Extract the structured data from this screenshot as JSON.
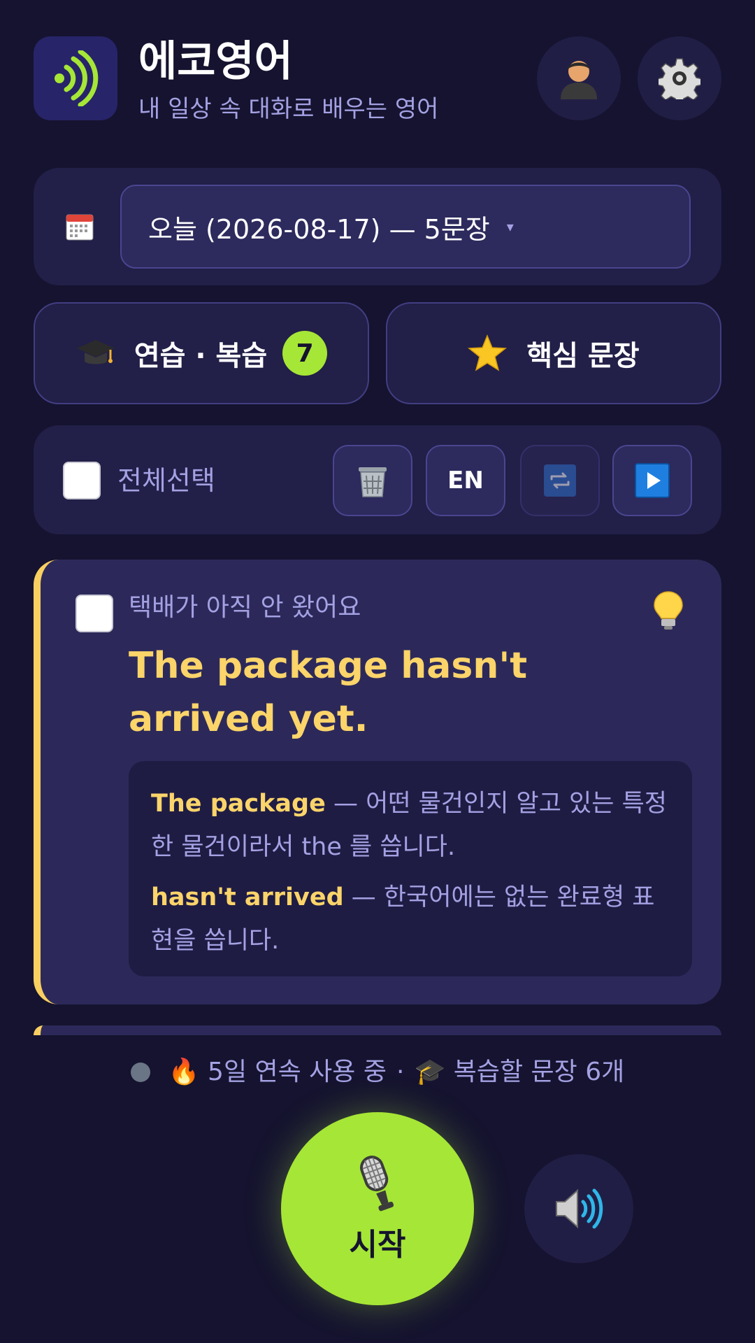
{
  "header": {
    "title": "에코영어",
    "subtitle": "내 일상 속 대화로 배우는 영어",
    "logo_icon": "echo-waves-icon",
    "profile_icon": "profile-icon",
    "settings_icon": "gear-icon"
  },
  "date_selector": {
    "icon": "calendar-icon",
    "value": "오늘 (2026-08-17) — 5문장",
    "caret": "▾"
  },
  "actions": {
    "practice_label": "연습 · 복습",
    "practice_badge": "7",
    "core_label": "핵심 문장"
  },
  "toolbar": {
    "select_all_label": "전체선택",
    "lang_label": "EN"
  },
  "card": {
    "korean": "택배가 아직 안 왔어요",
    "english": "The package hasn't arrived yet.",
    "explanations": [
      {
        "keyword": "The package",
        "text": " — 어떤 물건인지 알고 있는 특정한 물건이라서 the 를 씁니다."
      },
      {
        "keyword": "hasn't arrived",
        "text": " — 한국어에는 없는 완료형 표현을 씁니다."
      }
    ]
  },
  "status": {
    "streak": "🔥 5일 연속 사용 중",
    "separator": "·",
    "review": "🎓 복습할 문장 6개"
  },
  "controls": {
    "start_label": "시작",
    "mic_icon": "microphone-icon",
    "speaker_icon": "speaker-icon"
  },
  "colors": {
    "background": "#15132f",
    "panel": "#221f48",
    "card": "#2c295a",
    "accent_green": "#a6e636",
    "accent_yellow": "#fbd46a",
    "muted_text": "#a4a1e3"
  }
}
